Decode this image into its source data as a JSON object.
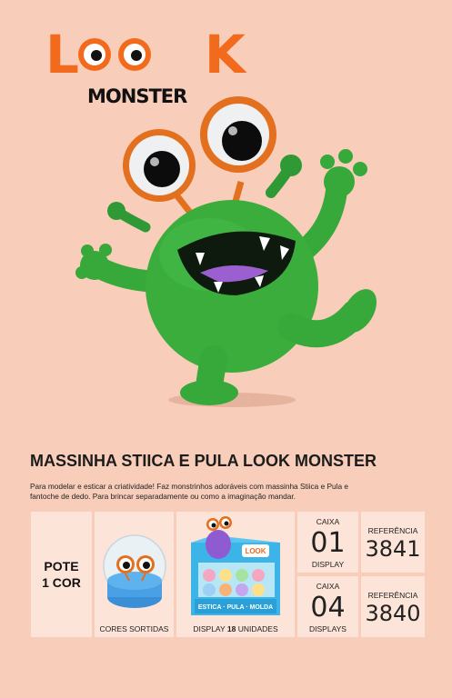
{
  "brand": {
    "logo_word": "LOOK",
    "logo_sub": "MONSTER"
  },
  "colors": {
    "background": "#f8cdb9",
    "brand_orange": "#f26b1d",
    "monster_green": "#35a83a",
    "panel": "#fde4d8"
  },
  "product": {
    "title": "MASSINHA STIICA E PULA LOOK MONSTER",
    "description_line1": "Para modelar e esticar a criatividade! Faz monstrinhos adoráveis com massinha Stiica e Pula e",
    "description_line2": "fantoche de dedo. Para brincar separadamente ou como a imaginação mandar."
  },
  "table": {
    "pote_line1": "POTE",
    "pote_line2": "1 COR",
    "cores_caption": "CORES SORTIDAS",
    "display_caption_prefix": "DISPLAY",
    "display_caption_number": "18",
    "display_caption_suffix": "UNIDADES",
    "display_box_label": "ESTICA · PULA · MOLDA",
    "rows": [
      {
        "caixa_label": "CAIXA",
        "caixa_number": "01",
        "caixa_unit": "DISPLAY",
        "ref_label": "REFERÊNCIA",
        "ref_number": "3841"
      },
      {
        "caixa_label": "CAIXA",
        "caixa_number": "04",
        "caixa_unit": "DISPLAYS",
        "ref_label": "REFERÊNCIA",
        "ref_number": "3840"
      }
    ]
  },
  "icons": {
    "hero": "green-monster-illustration",
    "jar": "dough-jar-icon",
    "display_box": "display-box-icon"
  }
}
